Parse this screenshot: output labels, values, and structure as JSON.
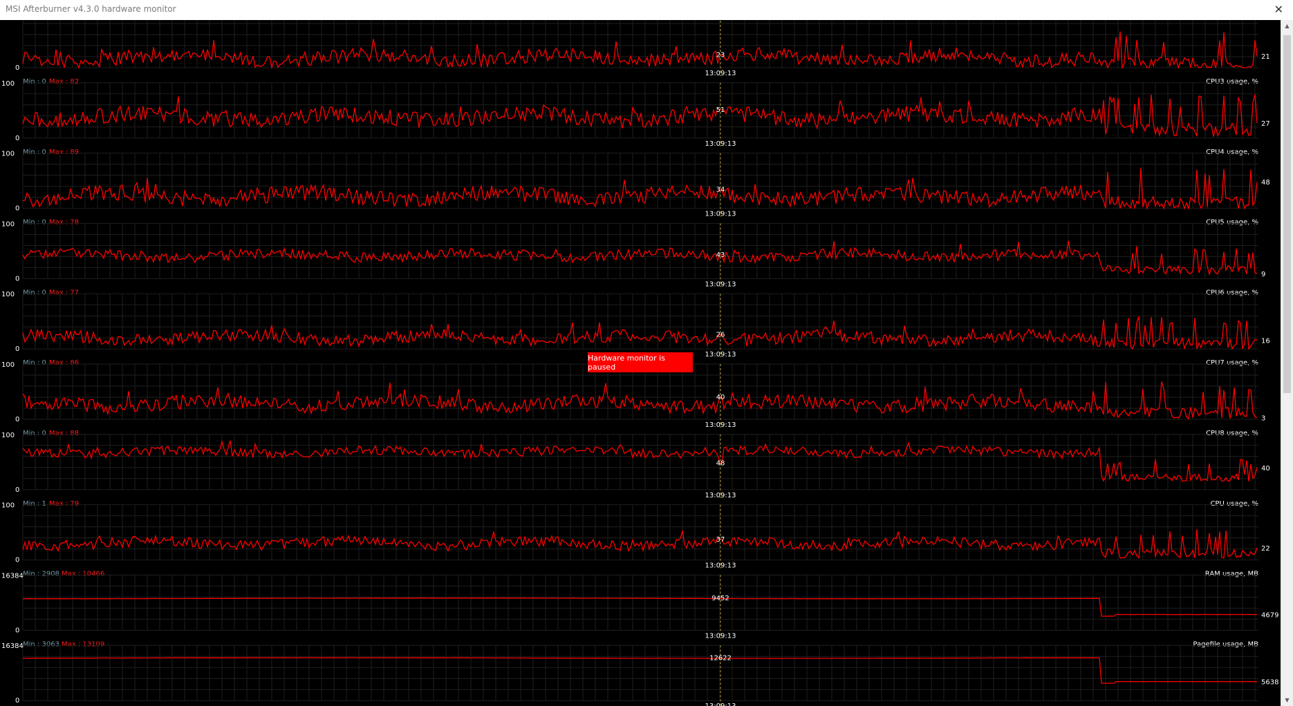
{
  "window": {
    "title": "MSI Afterburner v4.3.0 hardware monitor",
    "close_glyph": "✕",
    "scroll_up_glyph": "▲",
    "scroll_down_glyph": "▼"
  },
  "colors": {
    "background": "#000000",
    "grid": "#1f1f1f",
    "trace": "#ff0000",
    "min_text": "#6f9aa7",
    "max_text": "#ff1a1a",
    "banner": "#ff0000"
  },
  "status_banner": "Hardware monitor is paused",
  "cursor_time": "13:09:13",
  "graphs": [
    {
      "name": "CPU3 usage, %",
      "ymax": "100",
      "ymin": "0",
      "min_text": "Min : 0",
      "max_text": "Max : 82",
      "cursor_value": "23",
      "current_value": "21",
      "label_visible": true,
      "top_label_visible": false,
      "chart_data": {
        "type": "line",
        "ylim": [
          0,
          100
        ],
        "base": 18,
        "amp": 16,
        "drop_to": 5,
        "seed": 3,
        "cursor": 23,
        "current": 21
      }
    },
    {
      "name": "CPU4 usage, %",
      "ymax": "100",
      "ymin": "0",
      "min_text": "Min : 0",
      "max_text": "Max : 89",
      "cursor_value": "51",
      "current_value": "27",
      "label_visible": true,
      "top_label_visible": true,
      "chart_data": {
        "type": "line",
        "ylim": [
          0,
          100
        ],
        "base": 38,
        "amp": 18,
        "drop_to": 12,
        "seed": 4,
        "cursor": 51,
        "current": 27
      }
    },
    {
      "name": "CPU5 usage, %",
      "ymax": "100",
      "ymin": "0",
      "min_text": "Min : 0",
      "max_text": "Max : 78",
      "cursor_value": "34",
      "current_value": "48",
      "label_visible": true,
      "top_label_visible": true,
      "chart_data": {
        "type": "line",
        "ylim": [
          0,
          100
        ],
        "base": 22,
        "amp": 18,
        "drop_to": 8,
        "seed": 5,
        "cursor": 34,
        "current": 48
      }
    },
    {
      "name": "CPU6 usage, %",
      "ymax": "100",
      "ymin": "0",
      "min_text": "Min : 0",
      "max_text": "Max : 77",
      "cursor_value": "43",
      "current_value": "9",
      "label_visible": true,
      "top_label_visible": true,
      "chart_data": {
        "type": "line",
        "ylim": [
          0,
          100
        ],
        "base": 42,
        "amp": 12,
        "drop_to": 14,
        "seed": 6,
        "cursor": 43,
        "current": 9
      }
    },
    {
      "name": "CPU7 usage, %",
      "ymax": "100",
      "ymin": "0",
      "min_text": "Min : 0",
      "max_text": "Max : 86",
      "cursor_value": "26",
      "current_value": "16",
      "label_visible": true,
      "top_label_visible": true,
      "chart_data": {
        "type": "line",
        "ylim": [
          0,
          100
        ],
        "base": 20,
        "amp": 14,
        "drop_to": 8,
        "seed": 7,
        "cursor": 26,
        "current": 16
      }
    },
    {
      "name": "CPU8 usage, %",
      "ymax": "100",
      "ymin": "0",
      "min_text": "Min : 0",
      "max_text": "Max : 88",
      "cursor_value": "40",
      "current_value": "3",
      "label_visible": true,
      "top_label_visible": true,
      "chart_data": {
        "type": "line",
        "ylim": [
          0,
          100
        ],
        "base": 28,
        "amp": 16,
        "drop_to": 10,
        "seed": 8,
        "cursor": 40,
        "current": 3
      }
    },
    {
      "name": "CPU usage, %",
      "ymax": "100",
      "ymin": "0",
      "min_text": "Min : 1",
      "max_text": "Max : 79",
      "cursor_value": "48",
      "current_value": "40",
      "label_visible": true,
      "top_label_visible": true,
      "chart_data": {
        "type": "line",
        "ylim": [
          0,
          100
        ],
        "base": 68,
        "amp": 10,
        "drop_to": 20,
        "seed": 9,
        "cursor": 48,
        "current": 40
      }
    },
    {
      "name": "RAM usage, MB",
      "ymax": "100",
      "ymin": "0",
      "min_text": "Min : 2908",
      "max_text": "Max : 10466",
      "cursor_value": "37",
      "current_value": "22",
      "label_visible": true,
      "top_label_visible": true,
      "chart_data": {
        "type": "line",
        "ylim": [
          0,
          100
        ],
        "base": 30,
        "amp": 12,
        "drop_to": 10,
        "seed": 10,
        "cursor": 37,
        "current": 22
      }
    },
    {
      "name": "Pagefile usage, MB",
      "ymax": "16384",
      "ymin": "0",
      "min_text": "Min : 3063",
      "max_text": "Max : 13109",
      "cursor_value": "9452",
      "current_value": "4679",
      "label_visible": true,
      "top_label_visible": true,
      "smooth": true,
      "chart_data": {
        "type": "line",
        "ylim": [
          0,
          16384
        ],
        "level": 9452,
        "drop_to": 4679,
        "seed": 11,
        "cursor": 9452,
        "current": 4679
      }
    },
    {
      "name": "",
      "ymax": "16384",
      "ymin": "0",
      "min_text": "",
      "max_text": "",
      "cursor_value": "12622",
      "current_value": "5638",
      "label_visible": false,
      "top_label_visible": true,
      "smooth": true,
      "chart_data": {
        "type": "line",
        "ylim": [
          0,
          16384
        ],
        "level": 12622,
        "drop_to": 5638,
        "seed": 12,
        "cursor": 12622,
        "current": 5638
      }
    }
  ]
}
